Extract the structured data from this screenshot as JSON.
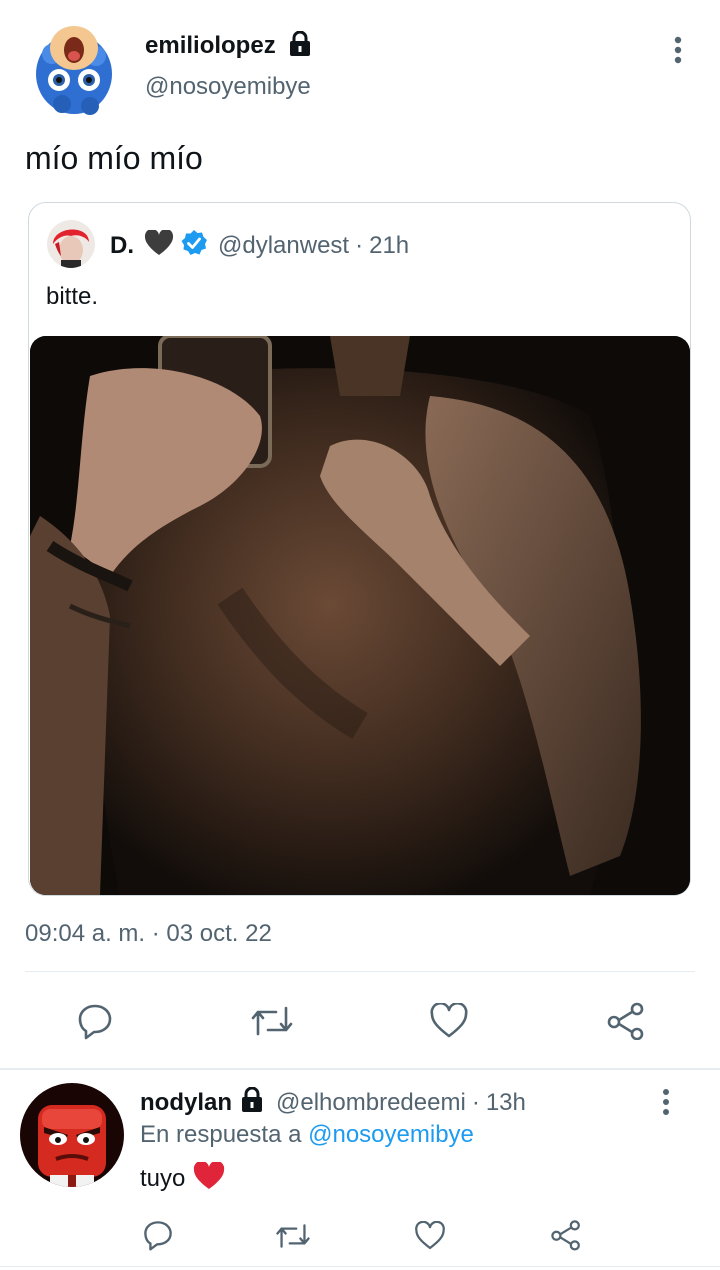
{
  "main_tweet": {
    "display_name": "emiliolopez",
    "handle": "@nosoyemibye",
    "text": "mío mío mío",
    "timestamp": "09:04 a. m.",
    "date_sep": "·",
    "date": "03 oct. 22"
  },
  "quoted_tweet": {
    "display_name": "D.",
    "handle": "@dylanwest",
    "dot": "·",
    "time": "21h",
    "text": "bitte."
  },
  "reply_tweet": {
    "display_name": "nodylan",
    "handle": "@elhombredeemi",
    "dot": "·",
    "time": "13h",
    "in_reply_prefix": "En respuesta a",
    "in_reply_handle": "@nosoyemibye",
    "text": "tuyo"
  },
  "icons": [
    "lock-icon",
    "more-vertical-icon",
    "verified-icon",
    "black-heart-emoji",
    "reply-icon",
    "retweet-icon",
    "like-icon",
    "share-icon",
    "red-heart-emoji"
  ],
  "colors": {
    "accent": "#1d9bf0",
    "secondary_text": "#536471",
    "separator": "#e6ecf0"
  }
}
